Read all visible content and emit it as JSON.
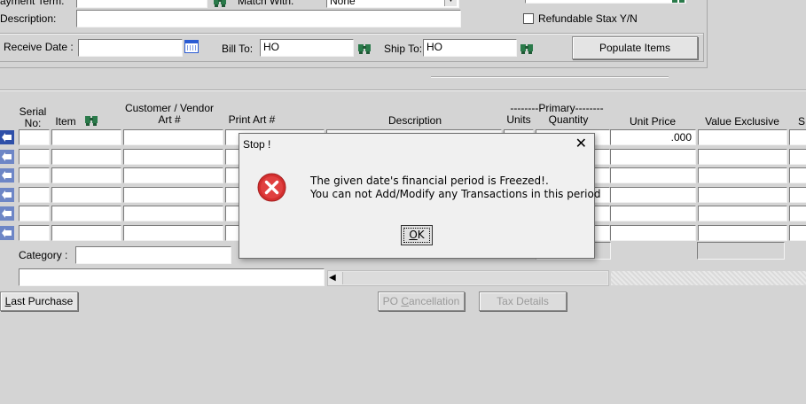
{
  "header": {
    "payment_term_label": "ayment Term:",
    "match_with_label": "Match With:",
    "match_with_value": "None",
    "description_label": "Description:",
    "refundable_label": "Refundable Stax Y/N",
    "receive_date_label": "Receive Date :",
    "bill_to_label": "Bill To:",
    "bill_to_value": "HO",
    "ship_to_label": "Ship To:",
    "ship_to_value": "HO",
    "populate_items_label": "Populate Items"
  },
  "grid": {
    "columns": {
      "serial": "Serial No:",
      "serial_line1": "Serial",
      "serial_line2": "No:",
      "item": "Item",
      "customer_vendor_line1": "Customer / Vendor",
      "customer_vendor_line2": "Art #",
      "print_art": "Print Art #",
      "description": "Description",
      "primary_group": "--------Primary--------",
      "units": "Units",
      "quantity": "Quantity",
      "unit_price": "Unit Price",
      "value_exclusive": "Value Exclusive",
      "next_col": "S"
    },
    "first_row_unit_price": ".000"
  },
  "footer": {
    "category_label": "Category :",
    "last_purchase_label": "Last Purchase",
    "last_purchase_mnemonic": "L",
    "last_purchase_rest": "ast Purchase",
    "po_cancellation_label": "PO Cancellation",
    "po_pre": "PO ",
    "po_mnemonic": "C",
    "po_rest": "ancellation",
    "tax_details_label": "Tax Details"
  },
  "dialog": {
    "title": "Stop !",
    "message_line1": "The given date's financial period is Freezed!.",
    "message_line2": "You can not Add/Modify any Transactions in this period",
    "ok_label": "OK",
    "ok_mnemonic": "O",
    "ok_rest": "K",
    "icon": "error-icon"
  },
  "colors": {
    "background": "#d4d4d4",
    "error_red": "#d32f2f",
    "row_icon_blue": "#2e4fa8"
  }
}
